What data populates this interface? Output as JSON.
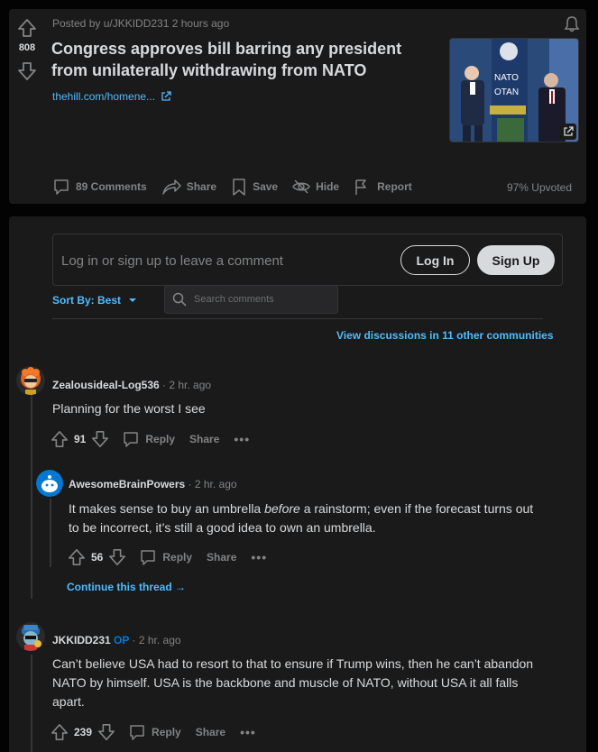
{
  "post": {
    "score": "808",
    "posted_by": "Posted by u/JKKIDD231 2 hours ago",
    "title": "Congress approves bill barring any president from unilaterally withdrawing from NATO",
    "link": "thehill.com/homene...",
    "thumbnail_text_1": "NATO",
    "thumbnail_text_2": "OTAN",
    "actions": {
      "comments": "89 Comments",
      "share": "Share",
      "save": "Save",
      "hide": "Hide",
      "report": "Report"
    },
    "upvoted": "97% Upvoted"
  },
  "comment_box": {
    "prompt": "Log in or sign up to leave a comment",
    "login": "Log In",
    "signup": "Sign Up"
  },
  "sort": {
    "label": "Sort By: Best"
  },
  "search": {
    "placeholder": "Search comments"
  },
  "view_discussions": "View discussions in 11 other communities",
  "comments": [
    {
      "author": "Zealousideal-Log536",
      "time": "· 2 hr. ago",
      "body": "Planning for the worst I see",
      "score": "91",
      "reply": "Reply",
      "share": "Share"
    },
    {
      "author": "AwesomeBrainPowers",
      "time": "· 2 hr. ago",
      "body_before": "It makes sense to buy an umbrella ",
      "body_em": "before",
      "body_after": " a rainstorm; even if the forecast turns out to be incorrect, it’s still a good idea to own an umbrella.",
      "score": "56",
      "reply": "Reply",
      "share": "Share",
      "continue": "Continue this thread"
    },
    {
      "author": "JKKIDD231",
      "flair": "OP",
      "time": "· 2 hr. ago",
      "body": "Can’t believe USA had to resort to that to ensure if Trump wins, then he can’t abandon NATO by himself. USA is the backbone and muscle of NATO, without USA it all falls apart.",
      "score": "239",
      "reply": "Reply",
      "share": "Share"
    }
  ],
  "colors": {
    "background": "#030303",
    "card": "#1a1a1b",
    "accent_link": "#4fbcff",
    "muted": "#818384",
    "text": "#d7dadc",
    "op": "#0079d3"
  }
}
